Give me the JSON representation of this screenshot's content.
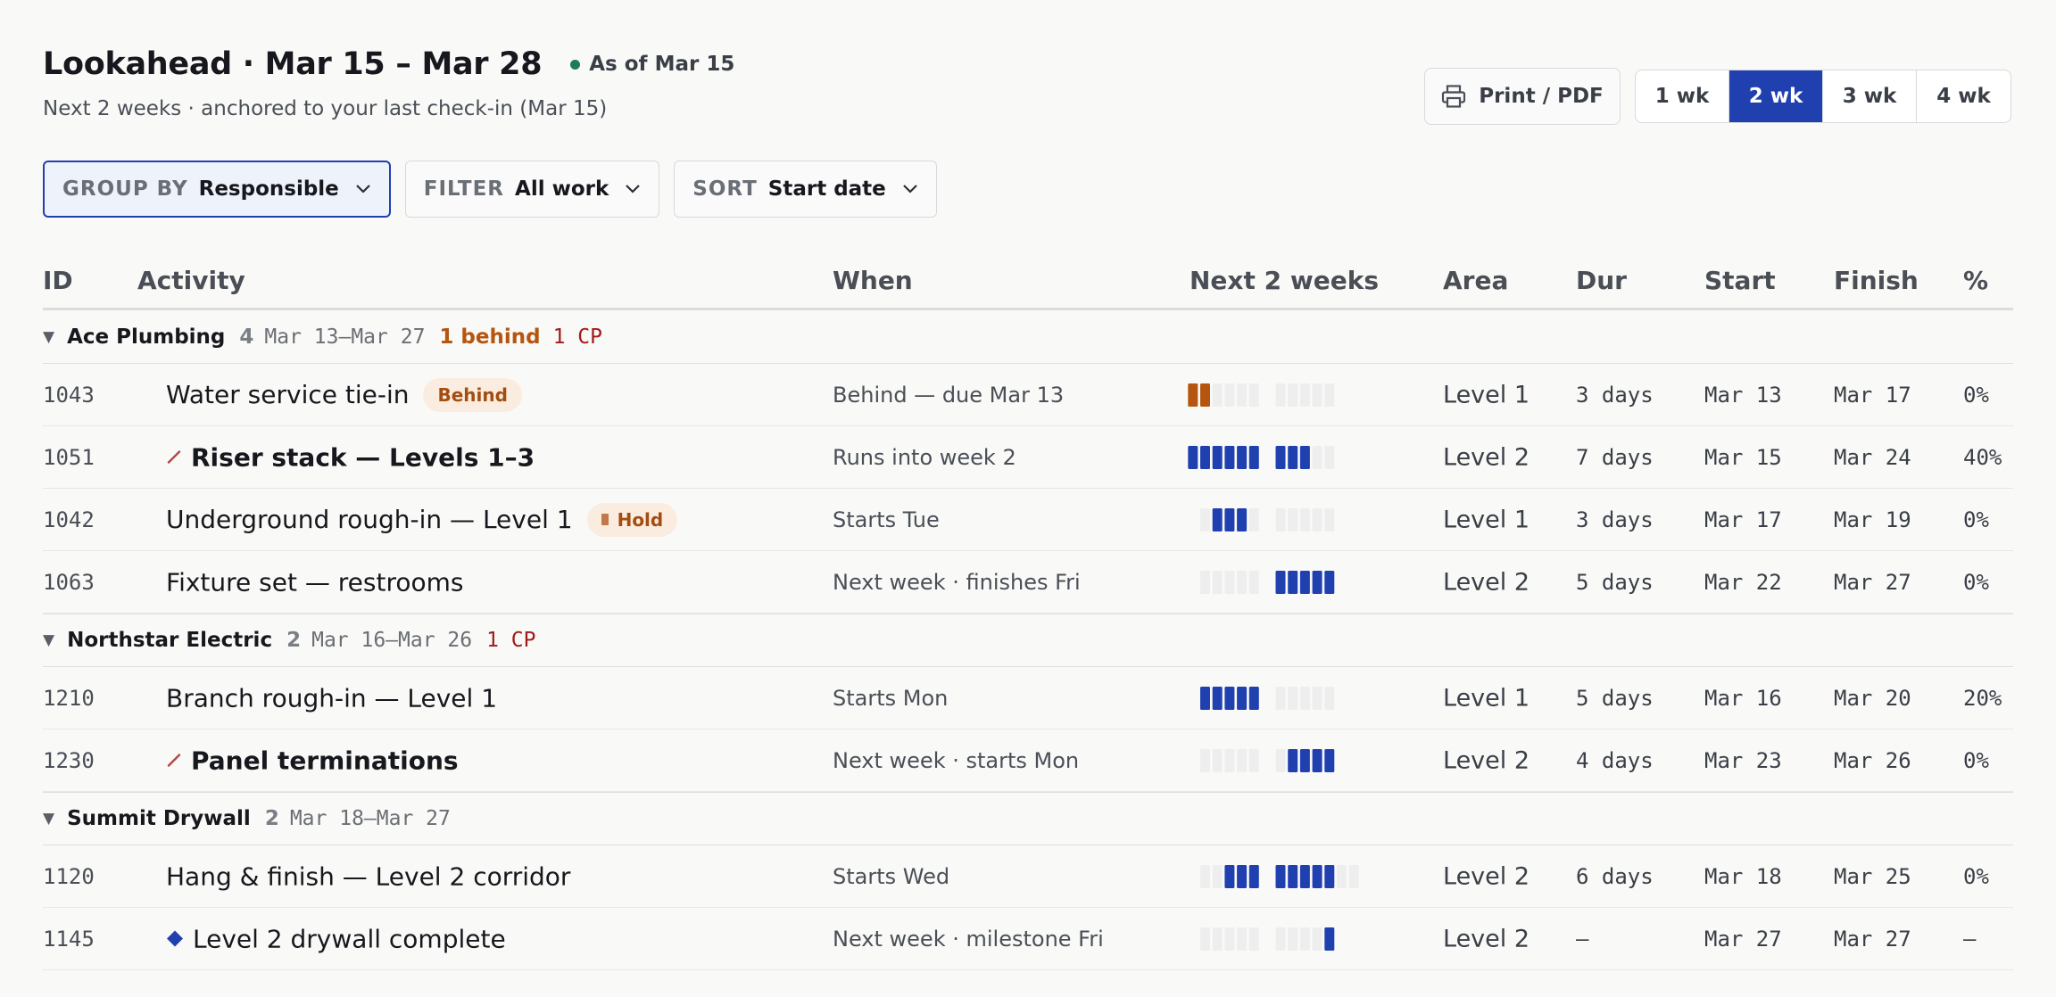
{
  "header": {
    "title": "Lookahead · Mar 15 – Mar 28",
    "as_of": "As of Mar 15",
    "subtitle": "Next 2 weeks · anchored to your last check-in (Mar 15)",
    "print_label": "Print / PDF"
  },
  "range_options": [
    {
      "label": "1 wk",
      "active": false
    },
    {
      "label": "2 wk",
      "active": true
    },
    {
      "label": "3 wk",
      "active": false
    },
    {
      "label": "4 wk",
      "active": false
    }
  ],
  "controls": {
    "group_key": "GROUP BY",
    "group_val": "Responsible",
    "filter_key": "FILTER",
    "filter_val": "All work",
    "sort_key": "SORT",
    "sort_val": "Start date"
  },
  "columns": {
    "id": "ID",
    "activity": "Activity",
    "when": "When",
    "bar": "Next 2 weeks",
    "area": "Area",
    "dur": "Dur",
    "start": "Start",
    "finish": "Finish",
    "pct": "%"
  },
  "colors": {
    "accent": "#2140b0",
    "behind": "#b5550f",
    "critical": "#a11a1a",
    "empty_cell": "#eeeeef"
  },
  "groups": [
    {
      "name": "Ace Plumbing",
      "count": "4",
      "range": "Mar 13–Mar 27",
      "behind": "1 behind",
      "cp": "1 CP",
      "rows": [
        {
          "id": "1043",
          "activity": "Water service tie-in",
          "badge": "Behind",
          "badge_type": "behind",
          "icon": "",
          "bold": false,
          "when": "Behind — due Mar 13",
          "area": "Level 1",
          "dur": "3 days",
          "start": "Mar 13",
          "finish": "Mar 17",
          "pct": "0%",
          "days": [
            3,
            3,
            3,
            0,
            0,
            0,
            0,
            0,
            0,
            0,
            0,
            0
          ],
          "first_day": -2
        },
        {
          "id": "1051",
          "activity": "Riser stack — Levels 1–3",
          "badge": "",
          "badge_type": "",
          "icon": "critical-path-icon",
          "bold": true,
          "when": "Runs into week 2",
          "area": "Level 2",
          "dur": "7 days",
          "start": "Mar 15",
          "finish": "Mar 24",
          "pct": "40%",
          "days": [
            1,
            1,
            1,
            1,
            1,
            1,
            1,
            1,
            1,
            1,
            0,
            0
          ],
          "first_day": -2
        },
        {
          "id": "1042",
          "activity": "Underground rough-in — Level 1",
          "badge": "Hold",
          "badge_type": "hold",
          "icon": "",
          "bold": false,
          "when": "Starts Tue",
          "area": "Level 1",
          "dur": "3 days",
          "start": "Mar 17",
          "finish": "Mar 19",
          "pct": "0%",
          "days": [
            0,
            1,
            1,
            1,
            0,
            0,
            0,
            0,
            0,
            0
          ],
          "first_day": 0
        },
        {
          "id": "1063",
          "activity": "Fixture set — restrooms",
          "badge": "",
          "badge_type": "",
          "icon": "",
          "bold": false,
          "when": "Next week · finishes Fri",
          "area": "Level 2",
          "dur": "5 days",
          "start": "Mar 22",
          "finish": "Mar 27",
          "pct": "0%",
          "days": [
            0,
            0,
            0,
            0,
            0,
            1,
            1,
            1,
            1,
            1
          ],
          "first_day": 0
        }
      ]
    },
    {
      "name": "Northstar Electric",
      "count": "2",
      "range": "Mar 16–Mar 26",
      "behind": "",
      "cp": "1 CP",
      "rows": [
        {
          "id": "1210",
          "activity": "Branch rough-in — Level 1",
          "badge": "",
          "badge_type": "",
          "icon": "",
          "bold": false,
          "when": "Starts Mon",
          "area": "Level 1",
          "dur": "5 days",
          "start": "Mar 16",
          "finish": "Mar 20",
          "pct": "20%",
          "days": [
            1,
            1,
            1,
            1,
            1,
            0,
            0,
            0,
            0,
            0
          ],
          "first_day": 0
        },
        {
          "id": "1230",
          "activity": "Panel terminations",
          "badge": "",
          "badge_type": "",
          "icon": "critical-path-icon",
          "bold": true,
          "when": "Next week · starts Mon",
          "area": "Level 2",
          "dur": "4 days",
          "start": "Mar 23",
          "finish": "Mar 26",
          "pct": "0%",
          "days": [
            0,
            0,
            0,
            0,
            0,
            0,
            1,
            1,
            1,
            1
          ],
          "first_day": 0
        }
      ]
    },
    {
      "name": "Summit Drywall",
      "count": "2",
      "range": "Mar 18–Mar 27",
      "behind": "",
      "cp": "",
      "rows": [
        {
          "id": "1120",
          "activity": "Hang & finish — Level 2 corridor",
          "badge": "",
          "badge_type": "",
          "icon": "",
          "bold": false,
          "when": "Starts Wed",
          "area": "Level 2",
          "dur": "6 days",
          "start": "Mar 18",
          "finish": "Mar 25",
          "pct": "0%",
          "days": [
            0,
            0,
            1,
            1,
            1,
            1,
            1,
            1,
            1,
            1,
            0,
            0
          ],
          "first_day": 0
        },
        {
          "id": "1145",
          "activity": "Level 2 drywall complete",
          "badge": "",
          "badge_type": "",
          "icon": "milestone-icon",
          "bold": false,
          "when": "Next week · milestone Fri",
          "area": "Level 2",
          "dur": "–",
          "start": "Mar 27",
          "finish": "Mar 27",
          "pct": "–",
          "days": [
            0,
            0,
            0,
            0,
            0,
            0,
            0,
            0,
            0,
            1
          ],
          "first_day": 0
        }
      ]
    }
  ]
}
